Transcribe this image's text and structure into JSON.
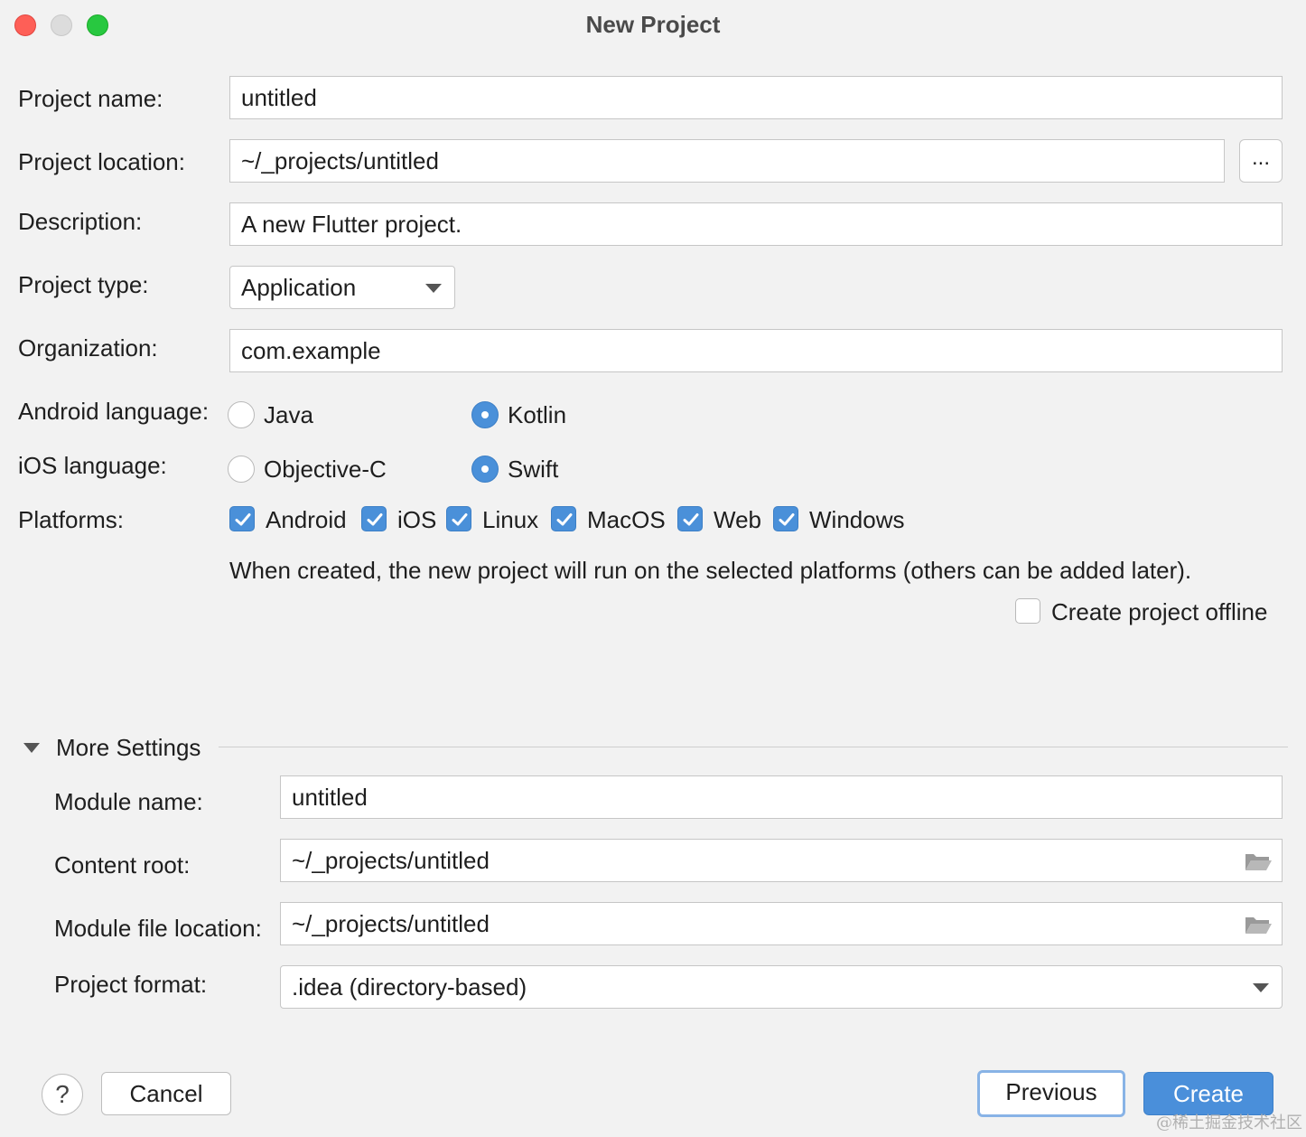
{
  "window": {
    "title": "New Project"
  },
  "form": {
    "project_name": {
      "label": "Project name:",
      "value": "untitled"
    },
    "project_location": {
      "label": "Project location:",
      "value": "~/_projects/untitled",
      "browse_label": "..."
    },
    "description": {
      "label": "Description:",
      "value": "A new Flutter project."
    },
    "project_type": {
      "label": "Project type:",
      "value": "Application"
    },
    "organization": {
      "label": "Organization:",
      "value": "com.example"
    },
    "android_language": {
      "label": "Android language:",
      "options": [
        "Java",
        "Kotlin"
      ],
      "selected": "Kotlin"
    },
    "ios_language": {
      "label": "iOS language:",
      "options": [
        "Objective-C",
        "Swift"
      ],
      "selected": "Swift"
    },
    "platforms": {
      "label": "Platforms:",
      "items": [
        {
          "label": "Android",
          "checked": true
        },
        {
          "label": "iOS",
          "checked": true
        },
        {
          "label": "Linux",
          "checked": true
        },
        {
          "label": "MacOS",
          "checked": true
        },
        {
          "label": "Web",
          "checked": true
        },
        {
          "label": "Windows",
          "checked": true
        }
      ],
      "hint": "When created, the new project will run on the selected platforms (others can be added later)."
    },
    "create_offline": {
      "label": "Create project offline",
      "checked": false
    }
  },
  "more_settings": {
    "title": "More Settings",
    "module_name": {
      "label": "Module name:",
      "value": "untitled"
    },
    "content_root": {
      "label": "Content root:",
      "value": "~/_projects/untitled"
    },
    "module_file_location": {
      "label": "Module file location:",
      "value": "~/_projects/untitled"
    },
    "project_format": {
      "label": "Project format:",
      "value": ".idea (directory-based)"
    }
  },
  "footer": {
    "help_label": "?",
    "cancel_label": "Cancel",
    "previous_label": "Previous",
    "create_label": "Create"
  },
  "watermark": "@稀土掘金技术社区",
  "colors": {
    "accent": "#4a8fda",
    "window_bg": "#f2f2f2",
    "close": "#fe5f57",
    "zoom": "#28c840"
  }
}
